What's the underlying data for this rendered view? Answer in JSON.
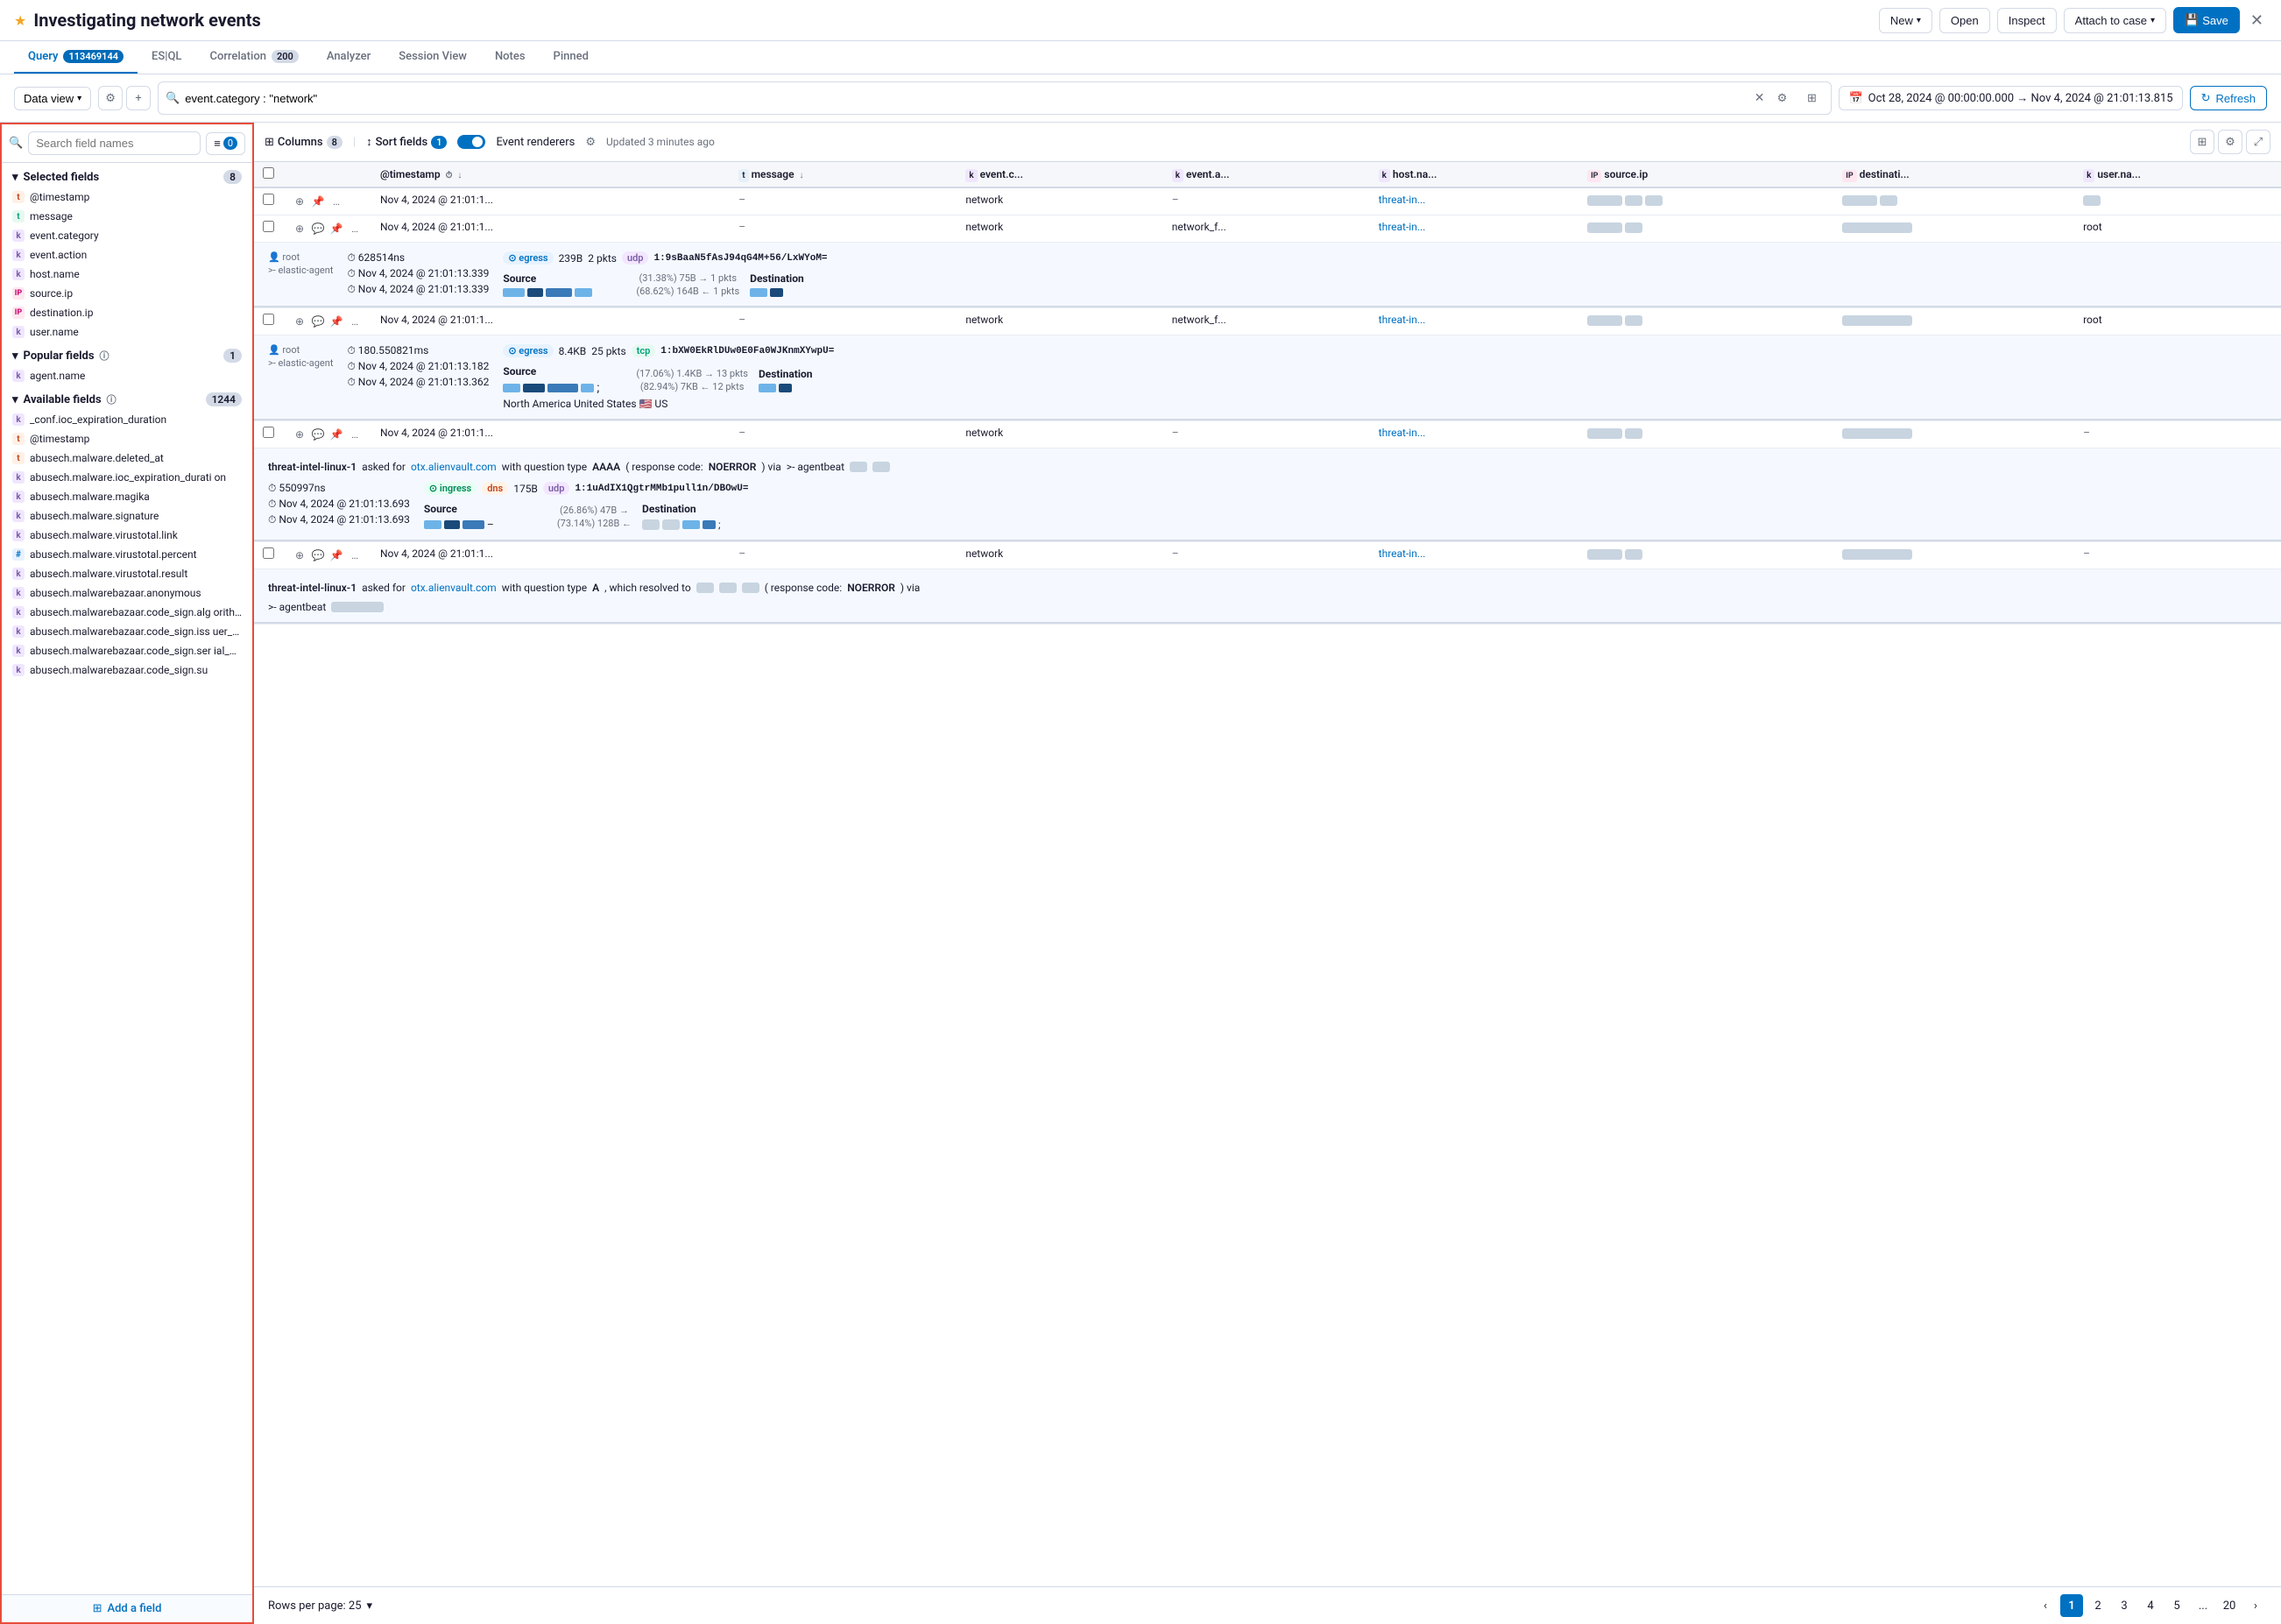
{
  "topBar": {
    "title": "Investigating network events",
    "star": "★",
    "buttons": {
      "new": "New",
      "open": "Open",
      "inspect": "Inspect",
      "attachToCase": "Attach to case",
      "save": "Save"
    }
  },
  "tabs": [
    {
      "id": "query",
      "label": "Query",
      "badge": "113469144",
      "active": true
    },
    {
      "id": "esql",
      "label": "ES|QL",
      "badge": null
    },
    {
      "id": "correlation",
      "label": "Correlation",
      "badge": "200"
    },
    {
      "id": "analyzer",
      "label": "Analyzer",
      "badge": null
    },
    {
      "id": "session-view",
      "label": "Session View",
      "badge": null
    },
    {
      "id": "notes",
      "label": "Notes",
      "badge": null
    },
    {
      "id": "pinned",
      "label": "Pinned",
      "badge": null
    }
  ],
  "toolbar": {
    "dataView": "Data view",
    "searchQuery": "event.category : \"network\"",
    "dateRange": "Oct 28, 2024 @ 00:00:00.000 → Nov 4, 2024 @ 21:01:13.815",
    "refresh": "Refresh"
  },
  "tableControls": {
    "columns": "Columns",
    "columnsCount": "8",
    "sortFields": "Sort fields",
    "sortCount": "1",
    "eventRenderers": "Event renderers",
    "updatedText": "Updated 3 minutes ago"
  },
  "leftPanel": {
    "searchPlaceholder": "Search field names",
    "filterCount": "0",
    "sections": {
      "selected": {
        "label": "Selected fields",
        "count": "8",
        "fields": [
          {
            "name": "@timestamp",
            "type": "date"
          },
          {
            "name": "message",
            "type": "text"
          },
          {
            "name": "event.category",
            "type": "keyword"
          },
          {
            "name": "event.action",
            "type": "keyword"
          },
          {
            "name": "host.name",
            "type": "keyword"
          },
          {
            "name": "source.ip",
            "type": "ip"
          },
          {
            "name": "destination.ip",
            "type": "ip"
          },
          {
            "name": "user.name",
            "type": "keyword"
          }
        ]
      },
      "popular": {
        "label": "Popular fields",
        "count": "1",
        "fields": [
          {
            "name": "agent.name",
            "type": "keyword"
          }
        ]
      },
      "available": {
        "label": "Available fields",
        "count": "1244",
        "fields": [
          {
            "name": "_conf.ioc_expiration_duration",
            "type": "keyword"
          },
          {
            "name": "@timestamp",
            "type": "date"
          },
          {
            "name": "abusech.malware.deleted_at",
            "type": "date"
          },
          {
            "name": "abusech.malware.ioc_expiration_duration",
            "type": "keyword"
          },
          {
            "name": "abusech.malware.magika",
            "type": "keyword"
          },
          {
            "name": "abusech.malware.signature",
            "type": "keyword"
          },
          {
            "name": "abusech.malware.virustotal.link",
            "type": "keyword"
          },
          {
            "name": "abusech.malware.virustotal.percent",
            "type": "number"
          },
          {
            "name": "abusech.malware.virustotal.result",
            "type": "keyword"
          },
          {
            "name": "abusech.malwarebazaar.anonymous",
            "type": "keyword"
          },
          {
            "name": "abusech.malwarebazaar.code_sign.algorithm",
            "type": "keyword"
          },
          {
            "name": "abusech.malwarebazaar.code_sign.issuer_cn",
            "type": "keyword"
          },
          {
            "name": "abusech.malwarebazaar.code_sign.serial_number",
            "type": "keyword"
          },
          {
            "name": "abusech.malwarebazaar.code_sign.su",
            "type": "keyword"
          }
        ]
      }
    },
    "addFieldLabel": "Add a field"
  },
  "tableHeaders": [
    {
      "id": "check",
      "label": ""
    },
    {
      "id": "actions",
      "label": ""
    },
    {
      "id": "timestamp",
      "label": "@timestamp"
    },
    {
      "id": "message",
      "label": "message"
    },
    {
      "id": "event_category",
      "label": "event.c..."
    },
    {
      "id": "event_action",
      "label": "event.a..."
    },
    {
      "id": "host_name",
      "label": "host.na..."
    },
    {
      "id": "source_ip",
      "label": "source.ip"
    },
    {
      "id": "destination",
      "label": "destinati..."
    },
    {
      "id": "user_name",
      "label": "user.na..."
    }
  ],
  "rows": [
    {
      "id": "row1",
      "timestamp": "Nov 4, 2024 @ 21:01:1...",
      "message": "–",
      "event_category": "network",
      "event_action": "–",
      "host_name": "threat-in...",
      "source_ip": "BLURRED",
      "destination": "BLURRED",
      "user_name": "BLURRED",
      "expanded": false
    },
    {
      "id": "row2",
      "timestamp": "Nov 4, 2024 @ 21:01:1...",
      "message": "–",
      "event_category": "network",
      "event_action": "network_f...",
      "host_name": "threat-in...",
      "source_ip": "BLURRED",
      "destination": "BLURRED",
      "user_name": "root",
      "expanded": true,
      "expandData": {
        "agent": "root",
        "agentSub": ">- elastic-agent",
        "duration": "628514ns",
        "ts1": "Nov 4, 2024 @ 21:01:13.339",
        "ts2": "Nov 4, 2024 @ 21:01:13.339",
        "direction": "egress",
        "bytes": "239B",
        "packets": "2 pkts",
        "protocol": "udp",
        "hash": "1:9sBaaN5fAsJ94qG4M+56/LxWYoM=",
        "sourceLabel": "Source",
        "destLabel": "Destination",
        "srcPct": "(31.38%) 75B",
        "srcArrow": "→",
        "srcPkts": "1 pkts",
        "dstPct": "(68.62%) 164B",
        "dstArrow": "←",
        "dstPkts": "1 pkts"
      }
    },
    {
      "id": "row3",
      "timestamp": "Nov 4, 2024 @ 21:01:1...",
      "message": "–",
      "event_category": "network",
      "event_action": "network_f...",
      "host_name": "threat-in...",
      "source_ip": "BLURRED",
      "destination": "BLURRED",
      "user_name": "root",
      "expanded": true,
      "expandData": {
        "agent": "root",
        "agentSub": ">- elastic-agent",
        "duration": "180.550821ms",
        "ts1": "Nov 4, 2024 @ 21:01:13.182",
        "ts2": "Nov 4, 2024 @ 21:01:13.362",
        "direction": "egress",
        "bytes": "8.4KB",
        "packets": "25 pkts",
        "protocol": "tcp",
        "hash": "1:bXW0EkRlDUw0E0Fa0WJKnmXYwpU=",
        "sourceLabel": "Source",
        "destLabel": "Destination",
        "srcPct": "(17.06%) 1.4KB",
        "srcArrow": "→",
        "srcPkts": "13 pkts",
        "dstPct": "(82.94%) 7KB",
        "dstArrow": "←",
        "dstPkts": "12 pkts",
        "country": "North America United States 🇺🇸 US"
      }
    },
    {
      "id": "row4",
      "timestamp": "Nov 4, 2024 @ 21:01:1...",
      "message": "–",
      "event_category": "network",
      "event_action": "–",
      "host_name": "threat-in...",
      "source_ip": "BLURRED",
      "destination": "BLURRED",
      "user_name": "–",
      "expanded": true,
      "expandData": {
        "type": "dns",
        "host": "threat-intel-linux-1",
        "askedFor": "otx.alienvault.com",
        "questionType": "AAAA",
        "responseCode": "NOERROR",
        "via": ">- agentbeat",
        "duration": "550997ns",
        "ts1": "Nov 4, 2024 @ 21:01:13.693",
        "ts2": "Nov 4, 2024 @ 21:01:13.693",
        "direction": "ingress",
        "directionBadge": "dns",
        "bytes": "175B",
        "protocol": "udp",
        "hash": "1:1uAdIX1QgtrMMb1pull1n/DBOwU=",
        "sourceLabel": "Source",
        "destLabel": "Destination",
        "srcPct": "(26.86%) 47B",
        "srcArrow": "→",
        "dstPct": "(73.14%) 128B",
        "dstArrow": "←"
      }
    },
    {
      "id": "row5",
      "timestamp": "Nov 4, 2024 @ 21:01:1...",
      "message": "–",
      "event_category": "network",
      "event_action": "–",
      "host_name": "threat-in...",
      "source_ip": "BLURRED",
      "destination": "BLURRED",
      "user_name": "–",
      "expanded": true,
      "expandData": {
        "type": "dns2",
        "host": "threat-intel-linux-1",
        "askedFor": "otx.alienvault.com",
        "questionType": "A",
        "resolved": "BLURRED",
        "responseCode": "NOERROR",
        "via": ">- agentbeat"
      }
    }
  ],
  "pagination": {
    "rowsPerPage": "Rows per page: 25",
    "pages": [
      "1",
      "2",
      "3",
      "4",
      "5",
      "...",
      "20"
    ],
    "activePage": "1",
    "prevArrow": "‹",
    "nextArrow": "›"
  }
}
